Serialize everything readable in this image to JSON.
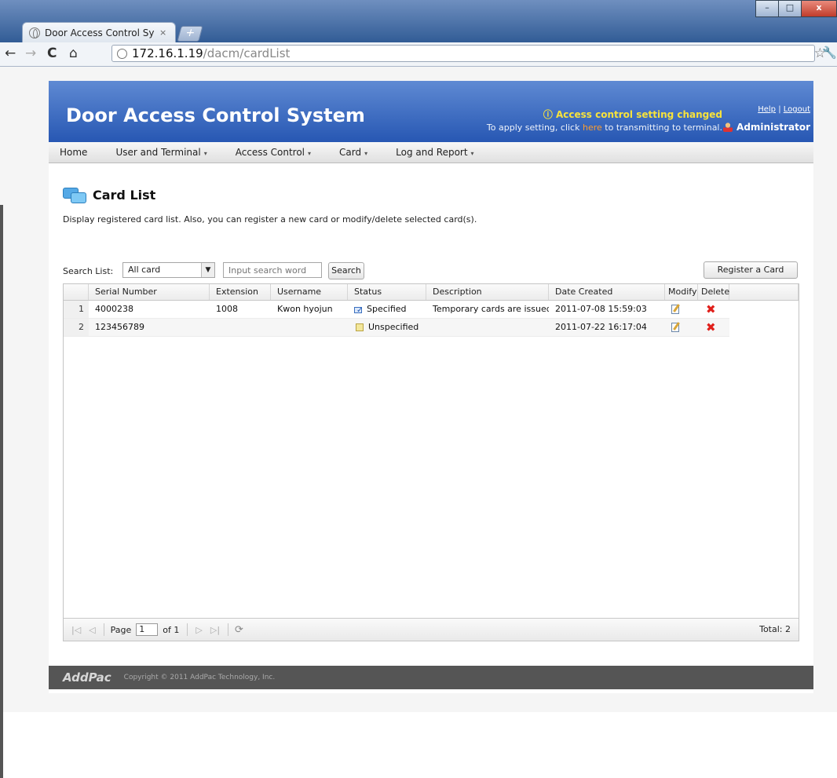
{
  "browser": {
    "tab_title": "Door Access Control Syste",
    "tab_close": "×",
    "new_tab": "+",
    "url_host": "172.16.1.19",
    "url_path": "/dacm/cardList",
    "back": "←",
    "forward": "→",
    "reload": "C",
    "home": "⌂",
    "star": "☆",
    "wrench": "🔧",
    "win_min": "–",
    "win_max": "□",
    "win_close": "x"
  },
  "header": {
    "app_title": "Door Access Control System",
    "notice_title": "ⓘ Access control setting changed",
    "notice_prefix": "To apply setting, click ",
    "notice_link": "here",
    "notice_suffix": " to transmitting to terminal.",
    "help": "Help",
    "link_sep": "|",
    "logout": "Logout",
    "user": "Administrator"
  },
  "menu": [
    {
      "label": "Home",
      "has_arrow": false
    },
    {
      "label": "User and Terminal",
      "has_arrow": true
    },
    {
      "label": "Access Control",
      "has_arrow": true
    },
    {
      "label": "Card",
      "has_arrow": true
    },
    {
      "label": "Log and Report",
      "has_arrow": true
    }
  ],
  "menu_arrow": "▾",
  "page": {
    "heading": "Card List",
    "description": "Display registered card list. Also, you can register a new card or modify/delete selected card(s)."
  },
  "search": {
    "label": "Search List:",
    "select_value": "All card",
    "select_chevron": "▼",
    "placeholder": "Input search word",
    "search_button": "Search",
    "register_button": "Register a Card"
  },
  "table": {
    "columns": [
      "",
      "Serial Number",
      "Extension",
      "Username",
      "Status",
      "Description",
      "Date Created",
      "Modify",
      "Delete",
      ""
    ],
    "rows": [
      {
        "num": "1",
        "serial": "4000238",
        "extension": "1008",
        "username": "Kwon hyojun",
        "status": "Specified",
        "status_icon": "specified-check-icon",
        "description": "Temporary cards are issued.",
        "date": "2011-07-08 15:59:03"
      },
      {
        "num": "2",
        "serial": "123456789",
        "extension": "",
        "username": "",
        "status": "Unspecified",
        "status_icon": "unspecified-square-icon",
        "description": "",
        "date": "2011-07-22 16:17:04"
      }
    ],
    "delete_glyph": "✖"
  },
  "pager": {
    "first": "|◁",
    "prev": "◁",
    "page_label": "Page",
    "page_value": "1",
    "of_label": "of 1",
    "next": "▷",
    "last": "▷|",
    "refresh": "⟳",
    "total": "Total: 2"
  },
  "footer": {
    "logo": "AddPac",
    "copyright": "Copyright © 2011 AddPac Technology, Inc."
  },
  "colors": {
    "header_top": "#5f8ad3",
    "header_bottom": "#2757b3",
    "notice_yellow": "#f8e33b",
    "here_orange": "#ff9e2c",
    "delete_red": "#e0201b",
    "footer_bg": "#555555"
  }
}
